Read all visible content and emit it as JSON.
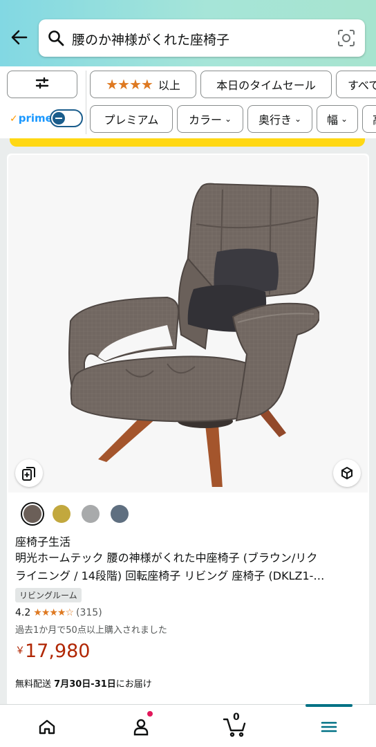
{
  "search": {
    "query": "腰のか神様がくれた座椅子"
  },
  "filters": {
    "row1": [
      {
        "label": "以上",
        "stars": "★★★★"
      },
      {
        "label": "本日のタイムセール"
      },
      {
        "label": "すべて"
      }
    ],
    "prime_label": "prime",
    "row2": [
      {
        "label": "プレミアム"
      },
      {
        "label": "カラー",
        "chevron": "⌄"
      },
      {
        "label": "奥行き",
        "chevron": "⌄"
      },
      {
        "label": "幅",
        "chevron": "⌄"
      },
      {
        "label": "高"
      }
    ]
  },
  "product": {
    "swatch_colors": [
      "#6b5f58",
      "#c2a83e",
      "#a8aaab",
      "#5f6f80"
    ],
    "brand": "座椅子生活",
    "title_line1": "明光ホームテック 腰の神様がくれた中座椅子 (ブラウン/リク",
    "title_line2": "ライニング / 14段階) 回転座椅子 リビング 座椅子 (DKLZ1-…",
    "tag": "リビングルーム",
    "rating": "4.2",
    "rating_stars": "★★★★☆",
    "rating_count": "(315)",
    "bought": "過去1か月で50点以上購入されました",
    "price_currency": "￥",
    "price_amount": "17,980",
    "delivery_prefix": "無料配送",
    "delivery_date": "7月30日-31日",
    "delivery_suffix": "にお届け"
  },
  "bottom_nav": {
    "cart_count": "0"
  },
  "icons": {
    "back": "back-arrow-icon",
    "search": "search-icon",
    "camera": "camera-scan-icon",
    "filter": "sliders-icon",
    "compare": "compare-cards-icon",
    "view3d": "ar-view-icon",
    "home": "home-icon",
    "account": "user-icon",
    "cart": "cart-icon",
    "menu": "menu-icon"
  },
  "colors": {
    "accent": "#007185",
    "price": "#b12704",
    "star": "#de7921",
    "prime": "#1a98ff",
    "deal_bar": "#ffd814"
  }
}
